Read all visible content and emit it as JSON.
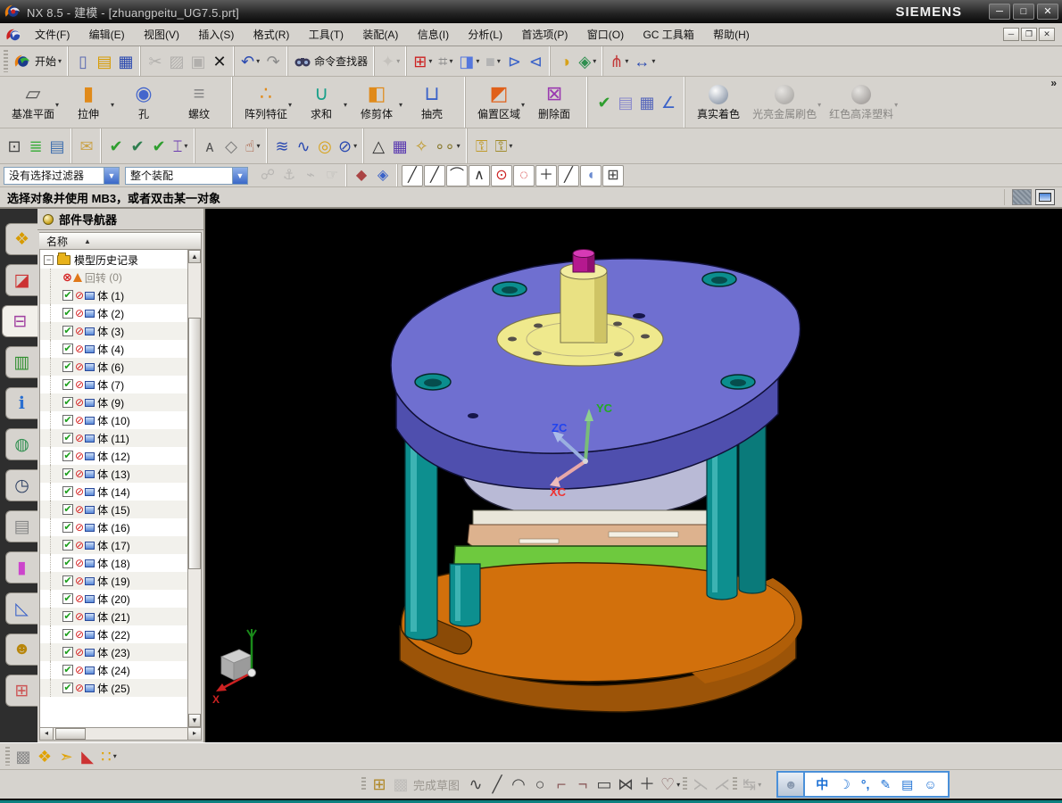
{
  "ui": {
    "caret": "▾",
    "overflow_chevron": "»",
    "sort_asc": "▲",
    "collapse_glyph": "−",
    "check_glyph": "✔",
    "no_update_glyph": "⊘",
    "suppressed_glyph": "⊗",
    "up_arrow": "▲",
    "down_arrow": "▼",
    "left_arrow": "◂",
    "right_arrow": "▸"
  },
  "window": {
    "title": "NX 8.5 - 建模 - [zhuangpeitu_UG7.5.prt]",
    "brand": "SIEMENS",
    "controls": {
      "minimize": "─",
      "maximize": "□",
      "close": "✕"
    }
  },
  "menubar": {
    "items": [
      {
        "n": "menu-file",
        "label": "文件(F)"
      },
      {
        "n": "menu-edit",
        "label": "编辑(E)"
      },
      {
        "n": "menu-view",
        "label": "视图(V)"
      },
      {
        "n": "menu-insert",
        "label": "插入(S)"
      },
      {
        "n": "menu-format",
        "label": "格式(R)"
      },
      {
        "n": "menu-tools",
        "label": "工具(T)"
      },
      {
        "n": "menu-assemblies",
        "label": "装配(A)"
      },
      {
        "n": "menu-information",
        "label": "信息(I)"
      },
      {
        "n": "menu-analysis",
        "label": "分析(L)"
      },
      {
        "n": "menu-preferences",
        "label": "首选项(P)"
      },
      {
        "n": "menu-window",
        "label": "窗口(O)"
      },
      {
        "n": "menu-gc-toolbox",
        "label": "GC 工具箱"
      },
      {
        "n": "menu-help",
        "label": "帮助(H)"
      }
    ],
    "mdi_controls": {
      "minimize": "─",
      "restore": "❐",
      "close": "✕"
    }
  },
  "toolbar_main": {
    "start_label": "开始",
    "command_finder_label": "命令查找器",
    "group_file": [
      {
        "n": "new-file-button",
        "g": "▯",
        "c": "#5a6ab0"
      },
      {
        "n": "open-file-button",
        "g": "▤",
        "c": "#d79b00"
      },
      {
        "n": "save-button",
        "g": "▦",
        "c": "#2a49b0"
      }
    ],
    "group_edit": [
      {
        "n": "cut-button",
        "g": "✂",
        "c": "#777",
        "d": true
      },
      {
        "n": "copy-button",
        "g": "▨",
        "c": "#777",
        "d": true
      },
      {
        "n": "paste-button",
        "g": "▣",
        "c": "#777",
        "d": true
      },
      {
        "n": "delete-button",
        "g": "✕",
        "c": "#1a1a1a"
      }
    ],
    "group_undo": [
      {
        "n": "undo-button",
        "g": "↶",
        "c": "#2a49b0",
        "caret": true
      },
      {
        "n": "redo-button",
        "g": "↷",
        "c": "#8a8a8a"
      }
    ],
    "group_finder_extra": [
      {
        "n": "touch-mode-button",
        "g": "✦",
        "c": "#b0a890",
        "d": true,
        "caret": true
      }
    ],
    "group_view": [
      {
        "n": "fit-view-button",
        "g": "⊞",
        "c": "#cc2222",
        "caret": true
      },
      {
        "n": "display-mode-button",
        "g": "⌗",
        "c": "#8a8a8a",
        "caret": true
      },
      {
        "n": "orient-view-cube-button",
        "g": "◨",
        "c": "#5577dd",
        "caret": true
      },
      {
        "n": "background-button",
        "g": "■",
        "c": "#b4b4b4",
        "caret": true
      },
      {
        "n": "show-hide-plane-button",
        "g": "⊳",
        "c": "#3a62c8"
      },
      {
        "n": "clip-section-button",
        "g": "⊲",
        "c": "#3a62c8"
      }
    ],
    "group_wcs": [
      {
        "n": "wcs-dynamics-button",
        "g": "◑",
        "c": "#d7a21a"
      },
      {
        "n": "move-object-button",
        "g": "◈",
        "c": "#2f8f4f",
        "caret": true
      }
    ],
    "group_measure": [
      {
        "n": "measure-angle-button",
        "g": "⋔",
        "c": "#c23a3a",
        "caret": true
      },
      {
        "n": "measure-distance-button",
        "g": "↔",
        "c": "#2a49b0",
        "caret": true
      }
    ]
  },
  "feature_toolbar": {
    "groups": [
      [
        {
          "n": "datum-plane-button",
          "label": "基准平面",
          "g": "▱",
          "c": "#555",
          "caret": true
        },
        {
          "n": "extrude-button",
          "label": "拉伸",
          "g": "▮",
          "c": "#e08a1a",
          "caret": true
        },
        {
          "n": "hole-button",
          "label": "孔",
          "g": "◉",
          "c": "#4466cc"
        },
        {
          "n": "thread-button",
          "label": "螺纹",
          "g": "≡",
          "c": "#8a8a8a"
        }
      ],
      [
        {
          "n": "pattern-feature-button",
          "label": "阵列特征",
          "g": "∴",
          "c": "#e08a1a",
          "caret": true
        },
        {
          "n": "unite-button",
          "label": "求和",
          "g": "∪",
          "c": "#19a08a",
          "caret": true
        },
        {
          "n": "trim-body-button",
          "label": "修剪体",
          "g": "◧",
          "c": "#e08a1a",
          "caret": true
        },
        {
          "n": "shell-button",
          "label": "抽壳",
          "g": "⊔",
          "c": "#3a62c8"
        }
      ],
      [
        {
          "n": "offset-region-button",
          "label": "偏置区域",
          "g": "◩",
          "c": "#e0601a",
          "caret": true
        },
        {
          "n": "delete-face-button",
          "label": "删除面",
          "g": "⊠",
          "c": "#9a3ab0"
        }
      ]
    ],
    "sync_icons": [
      {
        "n": "sync-modeling-check-button",
        "g": "✔",
        "c": "#2f9e2f"
      },
      {
        "n": "feature-playback-button",
        "g": "▤",
        "c": "#8888cc"
      },
      {
        "n": "part-table-button",
        "g": "▦",
        "c": "#5566bb"
      },
      {
        "n": "edit-csys-button",
        "g": "∠",
        "c": "#3a62c8"
      }
    ],
    "shading": [
      {
        "n": "true-shading-button",
        "label": "真实着色",
        "c": "#9aa4b2",
        "enabled": true
      },
      {
        "n": "shiny-metal-paint-button",
        "label": "光亮金属刷色",
        "c": "#8a7a72",
        "enabled": false,
        "caret": true
      },
      {
        "n": "red-gloss-plastic-button",
        "label": "红色高泽塑料",
        "c": "#8a5a5a",
        "enabled": false,
        "caret": true
      }
    ]
  },
  "utility_toolbar": {
    "groups": [
      [
        {
          "n": "select-window-button",
          "g": "⊡",
          "c": "#444"
        },
        {
          "n": "layer-visible-button",
          "g": "≣",
          "c": "#3fae3f"
        },
        {
          "n": "layer-settings-button",
          "g": "▤",
          "c": "#3f6fae"
        }
      ],
      [
        {
          "n": "annotation-note-button",
          "g": "✉",
          "c": "#caa34a"
        }
      ],
      [
        {
          "n": "show-body-check-button",
          "g": "✔",
          "c": "#2f9e2f"
        },
        {
          "n": "show-feature-check-button",
          "g": "✔",
          "c": "#2f7e4f"
        },
        {
          "n": "show-solid-check-button",
          "g": "✔",
          "c": "#2f9e2f"
        },
        {
          "n": "text-abc-button",
          "g": "⌶",
          "c": "#6a3ab0",
          "caret": true
        }
      ],
      [
        {
          "n": "appearance-a-button",
          "g": "ᴀ",
          "c": "#555"
        },
        {
          "n": "appearance-style-button",
          "g": "◇",
          "c": "#777"
        },
        {
          "n": "edit-display-button",
          "g": "☝",
          "c": "#a04a2a",
          "caret": true
        }
      ],
      [
        {
          "n": "coil-button",
          "g": "≋",
          "c": "#2a49b0"
        },
        {
          "n": "spring-button",
          "g": "∿",
          "c": "#2a49b0"
        },
        {
          "n": "washer-button",
          "g": "◎",
          "c": "#d7a21a"
        },
        {
          "n": "no-section-button",
          "g": "⊘",
          "c": "#2a49b0",
          "caret": true
        }
      ],
      [
        {
          "n": "triangle-datum-button",
          "g": "△",
          "c": "#333"
        },
        {
          "n": "table-tolerance-button",
          "g": "▦",
          "c": "#5a3ab0"
        },
        {
          "n": "point-set-folder-button",
          "g": "✧",
          "c": "#c09a2a"
        },
        {
          "n": "hole-set-folder-button",
          "g": "∘∘",
          "c": "#8a7a30",
          "caret": true
        }
      ],
      [
        {
          "n": "lock-feature-button",
          "g": "⚿",
          "c": "#c09a2a"
        },
        {
          "n": "unlock-feature-button",
          "g": "⚿",
          "c": "#a08a2a",
          "caret": true
        }
      ]
    ]
  },
  "selection_bar": {
    "filter_value": "没有选择过滤器",
    "scope_value": "整个装配",
    "icons_gray": [
      {
        "n": "select-assembly-button",
        "g": "☍",
        "c": "#888",
        "d": true
      },
      {
        "n": "select-component-low-button",
        "g": "⚓",
        "c": "#888",
        "d": true
      },
      {
        "n": "select-interpart-button",
        "g": "⌁",
        "c": "#888",
        "d": true
      },
      {
        "n": "select-gesture-button",
        "g": "☞",
        "c": "#888",
        "d": true
      }
    ],
    "icons_shade": [
      {
        "n": "highlight-shade-button",
        "g": "◆",
        "c": "#aa4444"
      },
      {
        "n": "highlight-box-button",
        "g": "◈",
        "c": "#3a62c8"
      }
    ],
    "snap_icons": [
      {
        "n": "snap-endpoint-button",
        "g": "╱",
        "c": "#333"
      },
      {
        "n": "snap-midpoint-button",
        "g": "╱",
        "c": "#333"
      },
      {
        "n": "snap-control-point-button",
        "g": "⌒",
        "c": "#333"
      },
      {
        "n": "snap-intersection-button",
        "g": "∧",
        "c": "#333"
      },
      {
        "n": "snap-arc-center-button",
        "g": "⊙",
        "c": "#cc2222"
      },
      {
        "n": "snap-quadrant-button",
        "g": "◌",
        "c": "#cc2222"
      },
      {
        "n": "snap-existing-point-button",
        "g": "＋",
        "c": "#333"
      },
      {
        "n": "snap-point-on-curve-button",
        "g": "╱",
        "c": "#333"
      },
      {
        "n": "snap-point-on-face-button",
        "g": "◖",
        "c": "#6a8ad0"
      },
      {
        "n": "snap-grid-button",
        "g": "⊞",
        "c": "#444"
      }
    ]
  },
  "prompt_bar": {
    "text": "选择对象并使用 MB3，或者双击某一对象"
  },
  "resource_bar": {
    "tabs": [
      {
        "n": "assembly-navigator-tab",
        "g": "❖",
        "c": "#d79b00"
      },
      {
        "n": "constraint-navigator-tab",
        "g": "◪",
        "c": "#cc3333"
      },
      {
        "n": "part-navigator-tab",
        "g": "⊟",
        "c": "#a040a0",
        "active": true
      },
      {
        "n": "reuse-library-tab",
        "g": "▥",
        "c": "#2f8f2f"
      },
      {
        "n": "hd3d-tools-tab",
        "g": "ℹ",
        "c": "#2a6fd0"
      },
      {
        "n": "web-browser-tab",
        "g": "◍",
        "c": "#2f8f4f"
      },
      {
        "n": "history-tab",
        "g": "◷",
        "c": "#334466"
      },
      {
        "n": "process-studio-tab",
        "g": "▤",
        "c": "#888888"
      },
      {
        "n": "manufacturing-wizard-tab",
        "g": "▮",
        "c": "#cc44cc"
      },
      {
        "n": "roles-tab",
        "g": "◺",
        "c": "#3a62c8"
      },
      {
        "n": "system-scenes-tab",
        "g": "☻",
        "c": "#b8860b"
      },
      {
        "n": "window-scene-tab",
        "g": "⊞",
        "c": "#cc5555"
      }
    ]
  },
  "navigator": {
    "title": "部件导航器",
    "name_column": "名称",
    "history_root": "模型历史记录",
    "suppressed_item": {
      "label": "回转",
      "count": "(0)"
    },
    "bodies": [
      "体 (1)",
      "体 (2)",
      "体 (3)",
      "体 (4)",
      "体 (6)",
      "体 (7)",
      "体 (9)",
      "体 (10)",
      "体 (11)",
      "体 (12)",
      "体 (13)",
      "体 (14)",
      "体 (15)",
      "体 (16)",
      "体 (17)",
      "体 (18)",
      "体 (19)",
      "体 (20)",
      "体 (21)",
      "体 (22)",
      "体 (23)",
      "体 (24)",
      "体 (25)"
    ]
  },
  "viewport": {
    "background": "#000000",
    "triad": {
      "x_label": "XC",
      "y_label": "YC",
      "z_label": "ZC",
      "x_color": "#ee3333",
      "y_color": "#22aa22",
      "z_color": "#2244ee"
    },
    "mini_axis_x_label": "X",
    "model_colors": {
      "top_plate": "#6f6fd0",
      "top_plate_side": "#4f4fae",
      "base": "#d2700c",
      "base_side": "#9c5408",
      "pillar": "#0d8f8f",
      "mid_plate": "#b9bad6",
      "green_plate": "#6ec93e",
      "tan_plate": "#ddb28e",
      "cream_ring": "#e9e6da",
      "boss": "#efe98d",
      "knob": "#b5198f",
      "hole": "#0b8e8e"
    }
  },
  "assembly_toolbar": {
    "icons": [
      {
        "n": "find-component-button",
        "g": "▩",
        "c": "#8a8a8a"
      },
      {
        "n": "add-component-button",
        "g": "❖",
        "c": "#e0a200"
      },
      {
        "n": "move-component-button",
        "g": "➣",
        "c": "#e0a200"
      },
      {
        "n": "assembly-constraints-button",
        "g": "◣",
        "c": "#cc3333"
      },
      {
        "n": "pattern-component-button",
        "g": "∷",
        "c": "#e0a200",
        "caret": true
      }
    ]
  },
  "sketch_toolbar": {
    "finish_label": "完成草图",
    "left_icons": [
      {
        "n": "sketch-in-task-env-button",
        "g": "⊞",
        "c": "#b0892a"
      },
      {
        "n": "sketch-preview-button",
        "g": "▩",
        "c": "#9a9a9a",
        "d": true
      }
    ],
    "curve_icons": [
      {
        "n": "profile-button",
        "g": "∿",
        "c": "#444"
      },
      {
        "n": "line-button",
        "g": "╱",
        "c": "#444"
      },
      {
        "n": "arc-button",
        "g": "◠",
        "c": "#444"
      },
      {
        "n": "circle-button",
        "g": "○",
        "c": "#444"
      },
      {
        "n": "fillet-button",
        "g": "⌐",
        "c": "#8a5a5a"
      },
      {
        "n": "chamfer-button",
        "g": "¬",
        "c": "#8a5a5a"
      },
      {
        "n": "rectangle-button",
        "g": "▭",
        "c": "#444"
      },
      {
        "n": "polygon-button",
        "g": "⋈",
        "c": "#444"
      },
      {
        "n": "point-button",
        "g": "＋",
        "c": "#444"
      },
      {
        "n": "studio-spline-button",
        "g": "♡",
        "c": "#8a6a6a",
        "caret": true
      }
    ],
    "trim_icons": [
      {
        "n": "quick-trim-button",
        "g": "⋋",
        "c": "#777",
        "d": true
      },
      {
        "n": "quick-extend-button",
        "g": "⋌",
        "c": "#777",
        "d": true
      }
    ],
    "dim_icons": [
      {
        "n": "sketch-dimension-button",
        "g": "↹",
        "c": "#777",
        "d": true,
        "caret": true
      }
    ]
  },
  "ime_bar": {
    "items": [
      {
        "n": "ime-mode-button",
        "g": "中"
      },
      {
        "n": "ime-halfmoon-button",
        "g": "☽"
      },
      {
        "n": "ime-punctuation-button",
        "g": "°,"
      },
      {
        "n": "ime-tools-button",
        "g": "✎"
      },
      {
        "n": "ime-softkeyboard-button",
        "g": "▤"
      },
      {
        "n": "ime-emoticon-button",
        "g": "☺"
      }
    ]
  }
}
